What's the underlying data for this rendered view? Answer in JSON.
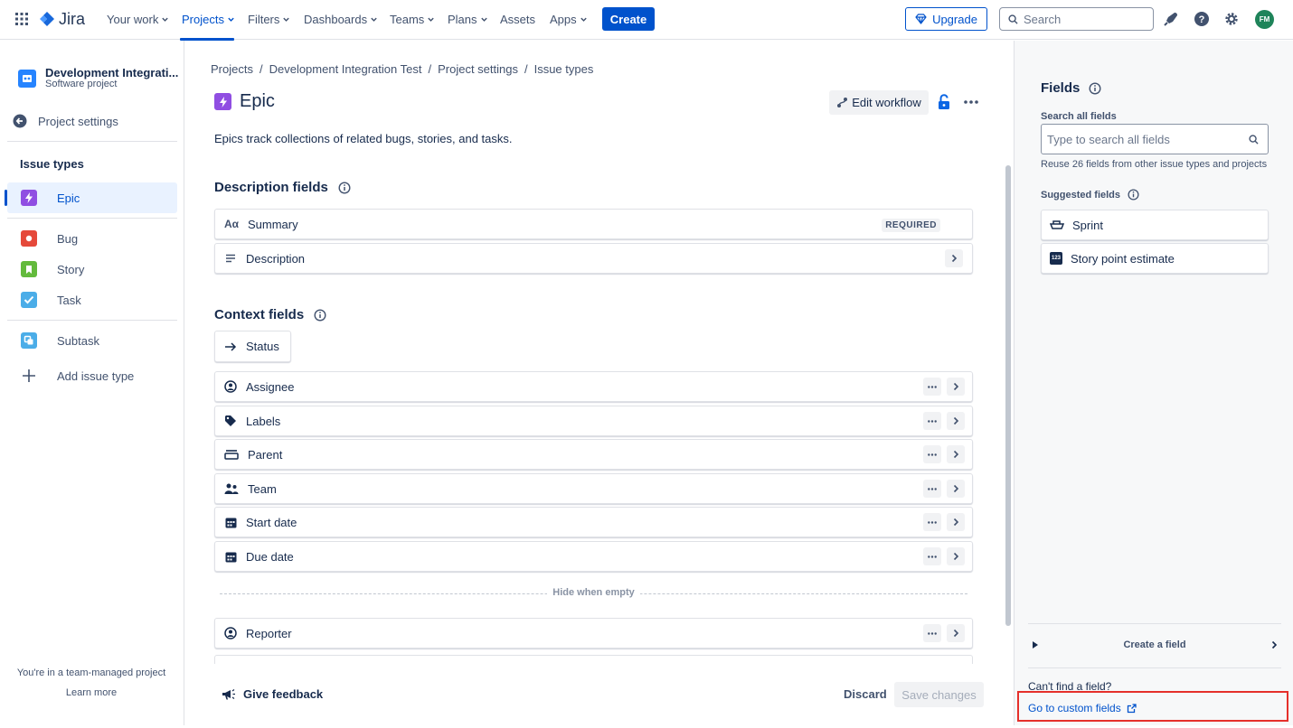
{
  "topbar": {
    "brand": "Jira",
    "nav": [
      {
        "label": "Your work",
        "has_chevron": true
      },
      {
        "label": "Projects",
        "has_chevron": true,
        "active": true
      },
      {
        "label": "Filters",
        "has_chevron": true
      },
      {
        "label": "Dashboards",
        "has_chevron": true
      },
      {
        "label": "Teams",
        "has_chevron": true
      },
      {
        "label": "Plans",
        "has_chevron": true
      },
      {
        "label": "Assets",
        "has_chevron": false
      },
      {
        "label": "Apps",
        "has_chevron": true
      }
    ],
    "create_label": "Create",
    "upgrade_label": "Upgrade",
    "search_placeholder": "Search",
    "avatar_initials": "FM",
    "accent_color": "#0052cc"
  },
  "sidebar": {
    "project_name": "Development Integrati...",
    "project_type": "Software project",
    "back_label": "Project settings",
    "section_heading": "Issue types",
    "issue_types": [
      {
        "label": "Epic",
        "icon": "epic-icon",
        "color": "#904ee2",
        "selected": true
      },
      {
        "label": "Bug",
        "icon": "bug-icon",
        "color": "#e5493a"
      },
      {
        "label": "Story",
        "icon": "story-icon",
        "color": "#63ba3c"
      },
      {
        "label": "Task",
        "icon": "task-icon",
        "color": "#4bade8"
      },
      {
        "label": "Subtask",
        "icon": "subtask-icon",
        "color": "#4bade8"
      }
    ],
    "add_label": "Add issue type",
    "footer_text": "You're in a team-managed project",
    "learn_more": "Learn more"
  },
  "main": {
    "breadcrumb": [
      "Projects",
      "Development Integration Test",
      "Project settings",
      "Issue types"
    ],
    "breadcrumb_sep": "/",
    "title": "Epic",
    "edit_workflow_label": "Edit workflow",
    "description": "Epics track collections of related bugs, stories, and tasks.",
    "description_fields_heading": "Description fields",
    "description_fields": [
      {
        "label": "Summary",
        "icon": "text-format-icon",
        "badge": "REQUIRED"
      },
      {
        "label": "Description",
        "icon": "paragraph-lines-icon"
      }
    ],
    "context_fields_heading": "Context fields",
    "status_label": "Status",
    "context_fields": [
      {
        "label": "Assignee",
        "icon": "person-circle-icon"
      },
      {
        "label": "Labels",
        "icon": "tag-icon"
      },
      {
        "label": "Parent",
        "icon": "parent-icon"
      },
      {
        "label": "Team",
        "icon": "people-icon"
      },
      {
        "label": "Start date",
        "icon": "calendar-icon"
      },
      {
        "label": "Due date",
        "icon": "calendar-icon"
      }
    ],
    "hide_when_empty_label": "Hide when empty",
    "hidden_fields": [
      {
        "label": "Reporter",
        "icon": "person-circle-icon"
      }
    ],
    "give_feedback_label": "Give feedback",
    "discard_label": "Discard",
    "save_label": "Save changes"
  },
  "right_panel": {
    "title": "Fields",
    "search_label": "Search all fields",
    "search_placeholder": "Type to search all fields",
    "reuse_hint": "Reuse 26 fields from other issue types and projects",
    "suggested_label": "Suggested fields",
    "suggested": [
      {
        "label": "Sprint",
        "icon": "sprint-icon"
      },
      {
        "label": "Story point estimate",
        "icon": "number-123-icon"
      }
    ],
    "create_field_label": "Create a field",
    "cant_find": "Can't find a field?",
    "custom_fields_link": "Go to custom fields"
  }
}
